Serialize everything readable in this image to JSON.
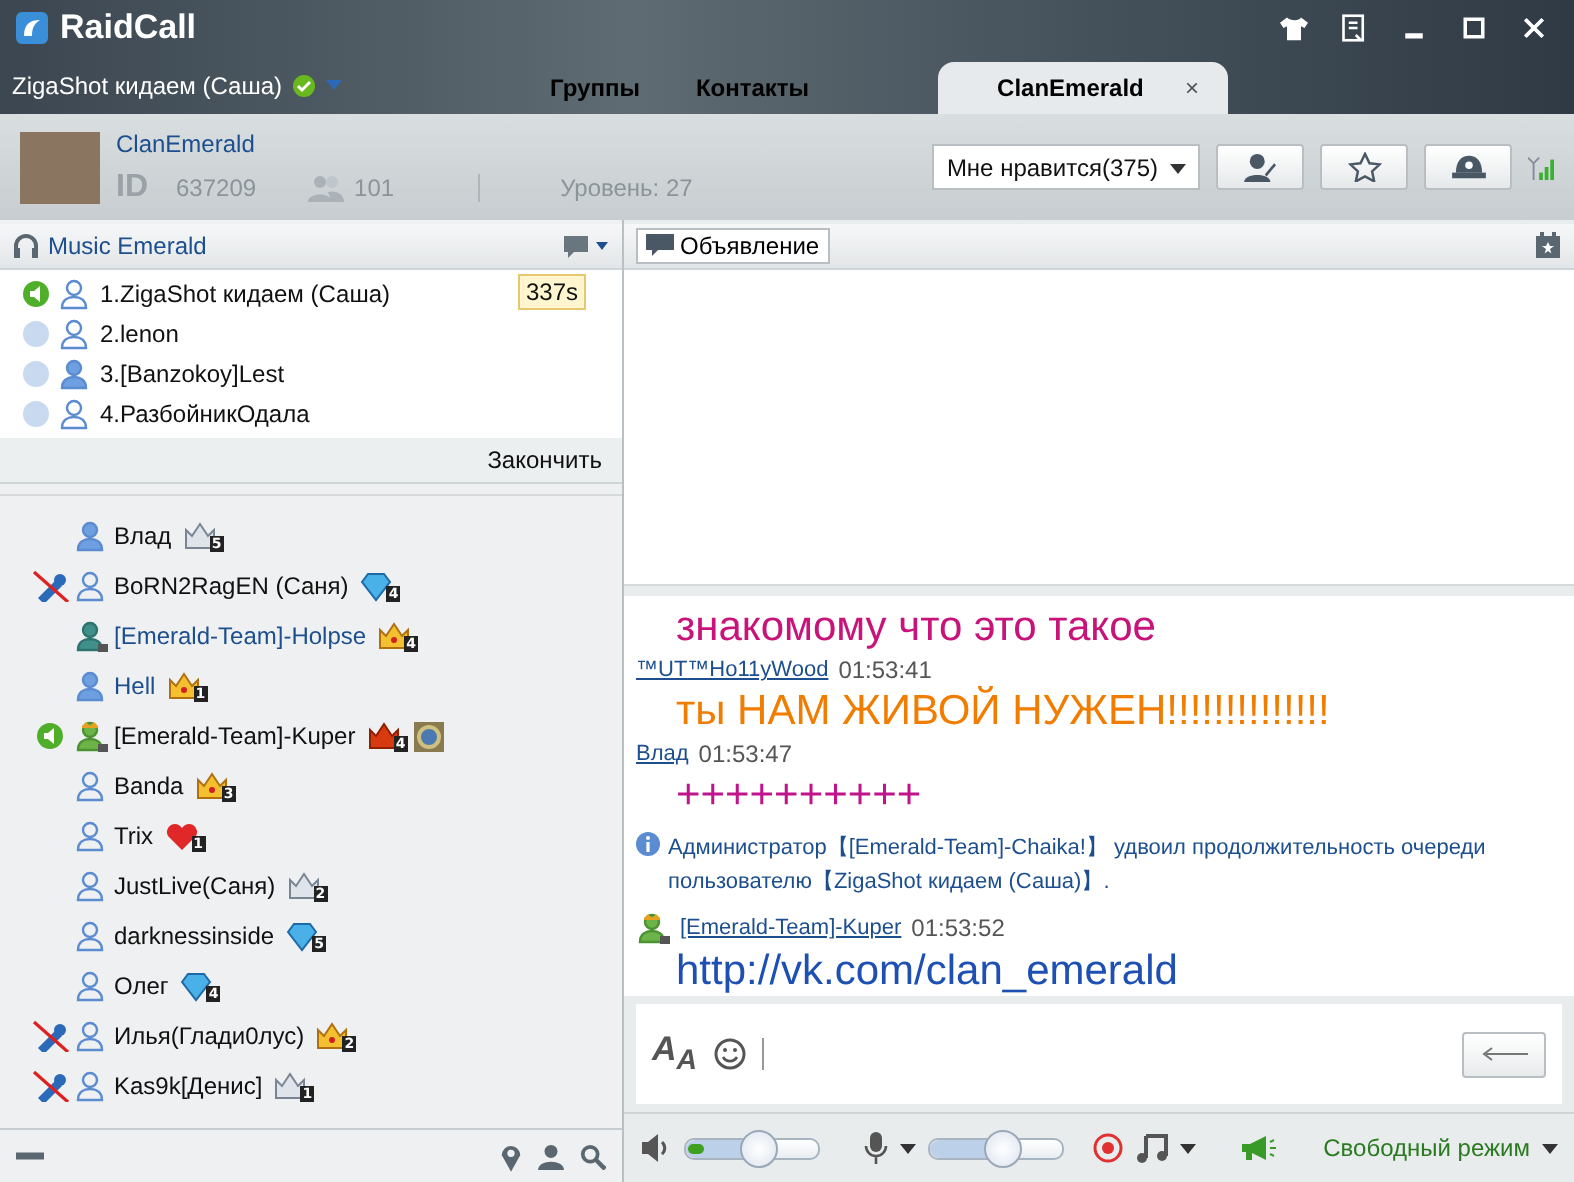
{
  "app": {
    "brand": "RaidCall",
    "user": "ZigaShot кидаем (Саша)",
    "online": true
  },
  "tabs": [
    {
      "label": "Группы",
      "selected": false
    },
    {
      "label": "Контакты",
      "selected": false
    },
    {
      "label": "ClanEmerald",
      "selected": true,
      "close": "×"
    }
  ],
  "group": {
    "name": "ClanEmerald",
    "id_label": "ID",
    "id": "637209",
    "members": "101",
    "level": "Уровень: 27",
    "like": "Мне нравится(375)"
  },
  "channel": {
    "name": "Music Emerald"
  },
  "queue": {
    "timer": "337s",
    "finish": "Закончить",
    "items": [
      {
        "name": "1.ZigaShot кидаем (Саша)",
        "speaking": true,
        "kind": "outline"
      },
      {
        "name": "2.lenon",
        "speaking": false,
        "kind": "outline"
      },
      {
        "name": "3.[Banzokoy]Lest",
        "speaking": false,
        "kind": "filled"
      },
      {
        "name": "4.РазбойникОдала",
        "speaking": false,
        "kind": "outline"
      }
    ]
  },
  "members": [
    {
      "name": "Влад",
      "mic_off": false,
      "speaking": false,
      "kind": "filled",
      "highlighted": false,
      "badges": [
        {
          "kind": "crown-silver",
          "level": "5"
        }
      ]
    },
    {
      "name": "BoRN2RagEN (Саня)",
      "mic_off": true,
      "speaking": false,
      "kind": "outline",
      "highlighted": false,
      "badges": [
        {
          "kind": "diamond",
          "level": "4"
        }
      ]
    },
    {
      "name": "[Emerald-Team]-Holpse",
      "mic_off": false,
      "speaking": false,
      "kind": "manager",
      "highlighted": true,
      "badges": [
        {
          "kind": "crown-gold",
          "level": "4"
        }
      ]
    },
    {
      "name": "Hell",
      "mic_off": false,
      "speaking": false,
      "kind": "filled",
      "highlighted": true,
      "badges": [
        {
          "kind": "crown-gold",
          "level": "1"
        }
      ]
    },
    {
      "name": "[Emerald-Team]-Kuper",
      "mic_off": false,
      "speaking": true,
      "kind": "owner",
      "highlighted": false,
      "badges": [
        {
          "kind": "heart-crown",
          "level": "4"
        },
        {
          "kind": "gear"
        }
      ]
    },
    {
      "name": "Banda",
      "mic_off": false,
      "speaking": false,
      "kind": "outline",
      "highlighted": false,
      "badges": [
        {
          "kind": "crown-gold",
          "level": "3"
        }
      ]
    },
    {
      "name": "Trix",
      "mic_off": false,
      "speaking": false,
      "kind": "outline",
      "highlighted": false,
      "badges": [
        {
          "kind": "heart",
          "level": "1"
        }
      ]
    },
    {
      "name": "JustLive(Саня)",
      "mic_off": false,
      "speaking": false,
      "kind": "outline",
      "highlighted": false,
      "badges": [
        {
          "kind": "crown-silver",
          "level": "2"
        }
      ]
    },
    {
      "name": "darknessinside",
      "mic_off": false,
      "speaking": false,
      "kind": "outline",
      "highlighted": false,
      "badges": [
        {
          "kind": "diamond",
          "level": "5"
        }
      ]
    },
    {
      "name": "Олег",
      "mic_off": false,
      "speaking": false,
      "kind": "outline",
      "highlighted": false,
      "badges": [
        {
          "kind": "diamond",
          "level": "4"
        }
      ]
    },
    {
      "name": "Илья(Глади0лус)",
      "mic_off": true,
      "speaking": false,
      "kind": "outline",
      "highlighted": false,
      "badges": [
        {
          "kind": "crown-gold",
          "level": "2"
        }
      ]
    },
    {
      "name": "Kas9k[Денис]",
      "mic_off": true,
      "speaking": false,
      "kind": "outline",
      "highlighted": false,
      "badges": [
        {
          "kind": "crown-silver",
          "level": "1"
        }
      ]
    }
  ],
  "announcement": {
    "label": "Объявление"
  },
  "chat": [
    {
      "kind": "text",
      "text": "знакомому что это такое",
      "color": "#c8147a"
    },
    {
      "kind": "author",
      "name": "™UT™Ho11yWood",
      "time": "01:53:41"
    },
    {
      "kind": "text",
      "text": "ты НАМ ЖИВОЙ НУЖЕН!!!!!!!!!!!!!!",
      "color": "#f07d00"
    },
    {
      "kind": "author",
      "name": "Влад",
      "time": "01:53:47"
    },
    {
      "kind": "text",
      "text": "++++++++++",
      "color": "#c0148c"
    },
    {
      "kind": "system",
      "text": "Администратор【[Emerald-Team]-Chaika!】 удвоил продолжительность очереди пользователю【ZigaShot кидаем (Саша)】."
    },
    {
      "kind": "author",
      "name": "[Emerald-Team]-Kuper",
      "time": "01:53:52",
      "manager": true
    },
    {
      "kind": "text",
      "text": "http://vk.com/clan_emerald",
      "color": "#1e50b4"
    }
  ],
  "input": {
    "font_button": "A$_{A}$"
  },
  "controls": {
    "speaker": {
      "level": 0.55
    },
    "meter": {
      "level": 0.12
    },
    "mic": {
      "level": 0.55
    },
    "mode": "Свободный режим"
  }
}
